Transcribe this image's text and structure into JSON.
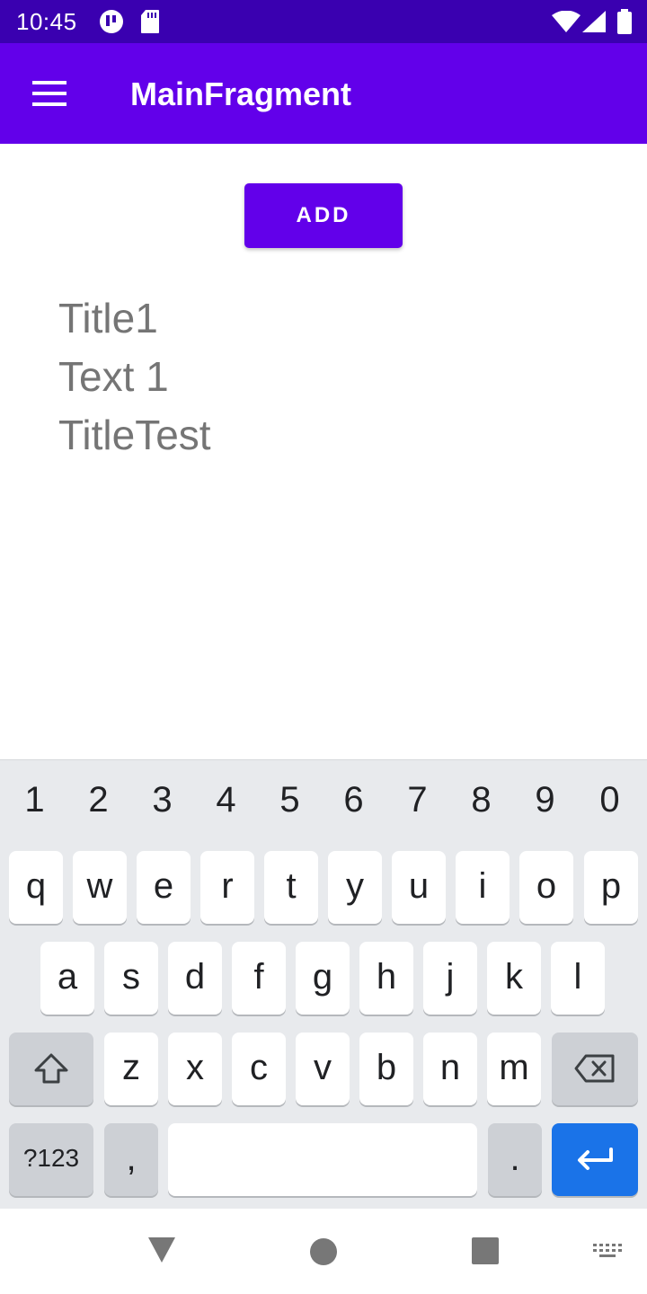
{
  "status_bar": {
    "time": "10:45",
    "icons": [
      "notification-app-icon",
      "sd-card-icon",
      "wifi-icon",
      "cellular-signal-icon",
      "battery-icon"
    ]
  },
  "app_bar": {
    "title": "MainFragment",
    "menu_icon": "hamburger-menu-icon"
  },
  "main": {
    "add_button_label": "ADD",
    "items": [
      "Title1",
      "Text 1",
      "TitleTest"
    ]
  },
  "keyboard": {
    "number_row": [
      "1",
      "2",
      "3",
      "4",
      "5",
      "6",
      "7",
      "8",
      "9",
      "0"
    ],
    "row1": [
      "q",
      "w",
      "e",
      "r",
      "t",
      "y",
      "u",
      "i",
      "o",
      "p"
    ],
    "row2": [
      "a",
      "s",
      "d",
      "f",
      "g",
      "h",
      "j",
      "k",
      "l"
    ],
    "row3": [
      "z",
      "x",
      "c",
      "v",
      "b",
      "n",
      "m"
    ],
    "symbols_label": "?123",
    "comma_label": ",",
    "period_label": ".",
    "shift_icon": "shift-icon",
    "backspace_icon": "backspace-icon",
    "enter_icon": "enter-icon"
  },
  "nav_bar": {
    "icons": [
      "back-icon",
      "home-icon",
      "recents-icon",
      "keyboard-switch-icon"
    ]
  },
  "colors": {
    "status_bar": "#3a00b0",
    "primary": "#6200ea",
    "keyboard_bg": "#e8eaed",
    "enter_key": "#1a73e8"
  }
}
